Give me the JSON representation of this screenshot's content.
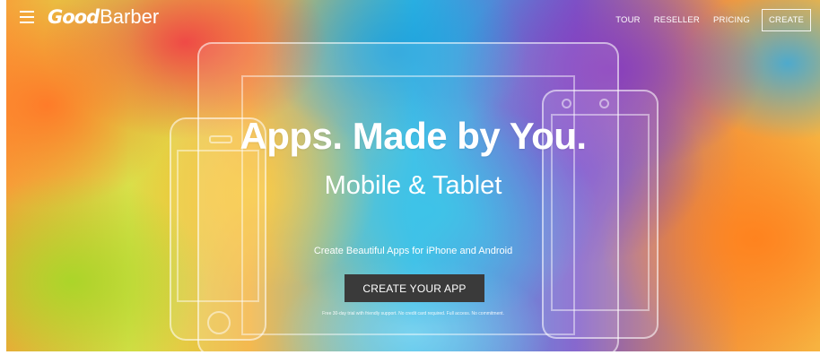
{
  "brand": {
    "logo_good": "Good",
    "logo_barber": "Barber"
  },
  "nav": {
    "menu_icon": "hamburger-menu-icon",
    "links": [
      "TOUR",
      "RESELLER",
      "PRICING"
    ],
    "create_label": "CREATE"
  },
  "hero": {
    "headline": "Apps. Made by You.",
    "subhead": "Mobile & Tablet",
    "tagline": "Create Beautiful Apps for iPhone and Android",
    "cta_label": "CREATE YOUR APP",
    "fineprint": "Free 30-day trial with friendly support. No credit card required. Full access. No commitment."
  },
  "colors": {
    "cta_background": "#3a3a3a",
    "text": "#ffffff"
  }
}
